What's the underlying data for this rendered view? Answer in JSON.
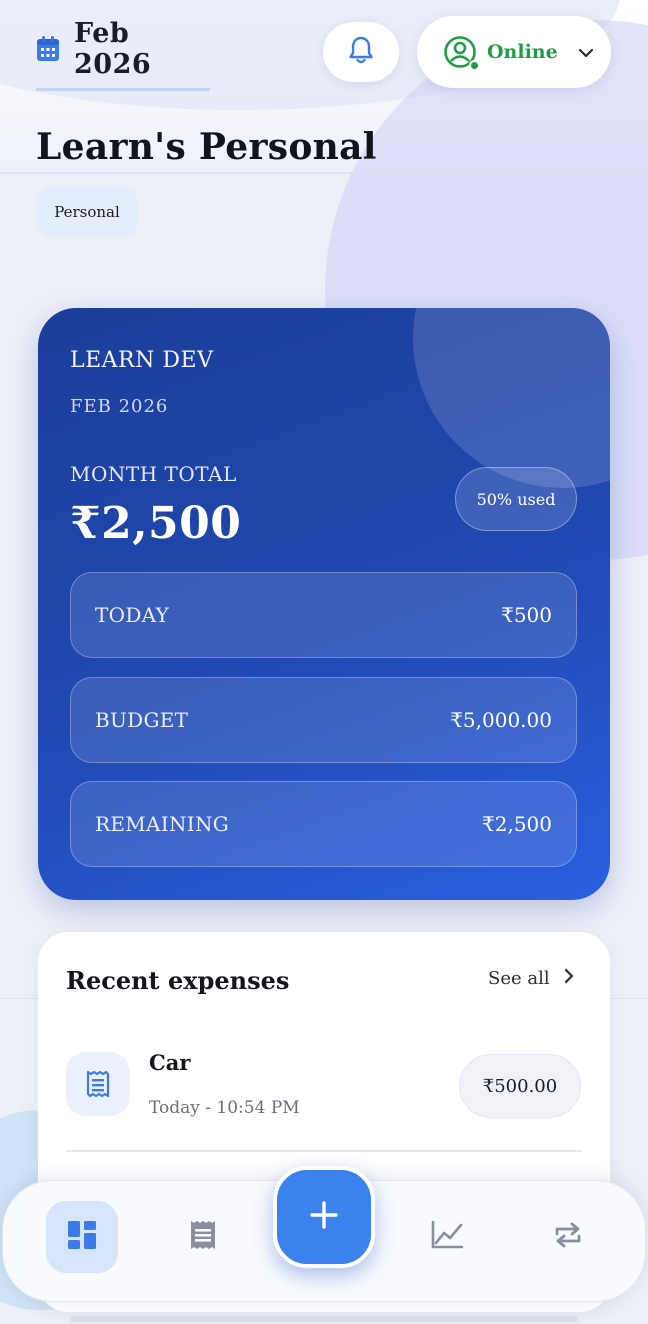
{
  "header": {
    "date_label": "Feb 2026",
    "status_label": "Online"
  },
  "page": {
    "title": "Learn's Personal",
    "tag": "Personal"
  },
  "summary": {
    "name": "LEARN DEV",
    "month": "FEB 2026",
    "month_total_label": "MONTH TOTAL",
    "month_total_value": "₹2,500",
    "used_label": "50% used",
    "stats": [
      {
        "label": "TODAY",
        "value": "₹500"
      },
      {
        "label": "BUDGET",
        "value": "₹5,000.00"
      },
      {
        "label": "REMAINING",
        "value": "₹2,500"
      }
    ]
  },
  "recent": {
    "title": "Recent expenses",
    "see_all": "See all",
    "items": [
      {
        "title": "Car",
        "time": "Today - 10:54 PM",
        "amount": "₹500.00"
      }
    ]
  },
  "nav": {
    "items": [
      {
        "icon": "dashboard-icon",
        "active": true
      },
      {
        "icon": "receipt-list-icon",
        "active": false
      },
      {
        "icon": "add-icon",
        "active": false
      },
      {
        "icon": "chart-icon",
        "active": false
      },
      {
        "icon": "recurring-icon",
        "active": false
      }
    ]
  },
  "colors": {
    "accent": "#3b82ee",
    "hero_start": "#1c3e9a",
    "hero_end": "#2a5fe0",
    "online": "#1f9d45"
  }
}
